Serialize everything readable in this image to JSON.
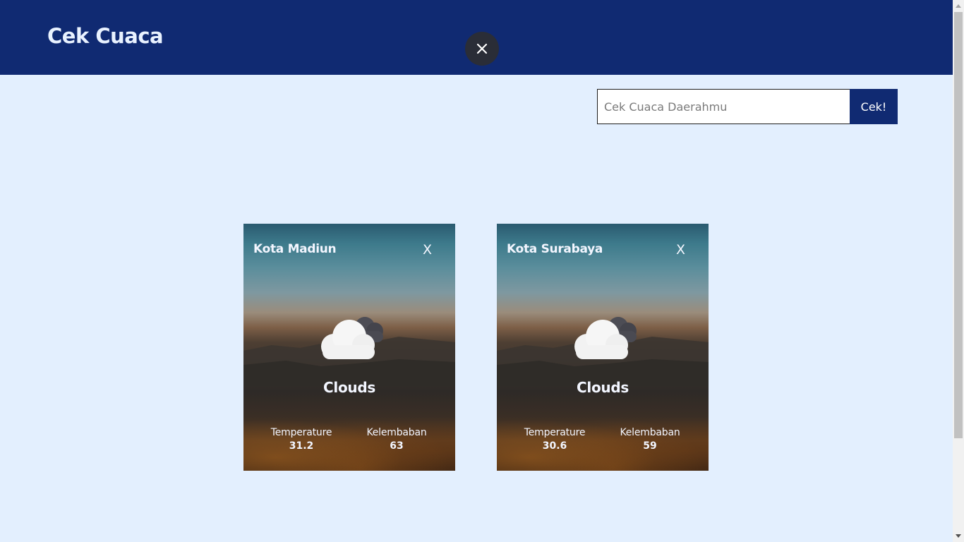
{
  "app": {
    "title": "Cek Cuaca"
  },
  "search": {
    "placeholder": "Cek Cuaca Daerahmu",
    "button_label": "Cek!"
  },
  "overlay": {
    "close_icon": "close-icon"
  },
  "cards": [
    {
      "city": "Kota Madiun",
      "close_label": "X",
      "condition": "Clouds",
      "icon": "clouds-icon",
      "temperature_label": "Temperature",
      "temperature_value": "31.2",
      "humidity_label": "Kelembaban",
      "humidity_value": "63"
    },
    {
      "city": "Kota Surabaya",
      "close_label": "X",
      "condition": "Clouds",
      "icon": "clouds-icon",
      "temperature_label": "Temperature",
      "temperature_value": "30.6",
      "humidity_label": "Kelembaban",
      "humidity_value": "59"
    }
  ],
  "colors": {
    "header_bg": "#102a72",
    "page_bg": "#e3effe",
    "button_bg": "#102a72",
    "overlay_close_bg": "#2a2d37"
  }
}
